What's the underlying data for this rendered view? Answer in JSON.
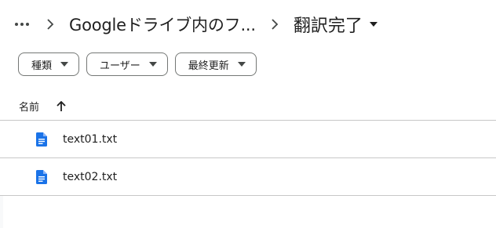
{
  "breadcrumb": {
    "more_icon": "more-horiz-icon",
    "separator_icon": "chevron-right-icon",
    "parent_label": "Googleドライブ内のフ...",
    "current_label": "翻訳完了",
    "current_caret_icon": "caret-down-icon"
  },
  "filters": [
    {
      "label": "種類",
      "icon": "caret-down-icon"
    },
    {
      "label": "ユーザー",
      "icon": "caret-down-icon"
    },
    {
      "label": "最終更新",
      "icon": "caret-down-icon"
    }
  ],
  "table": {
    "name_header": "名前",
    "sort_icon": "arrow-up-icon",
    "rows": [
      {
        "name": "text01.txt",
        "icon": "google-docs-icon"
      },
      {
        "name": "text02.txt",
        "icon": "google-docs-icon"
      }
    ]
  },
  "colors": {
    "doc_icon": "#1a73e8",
    "text": "#1f1f1f",
    "divider": "#c7c7c7",
    "chip_border": "#747775"
  }
}
